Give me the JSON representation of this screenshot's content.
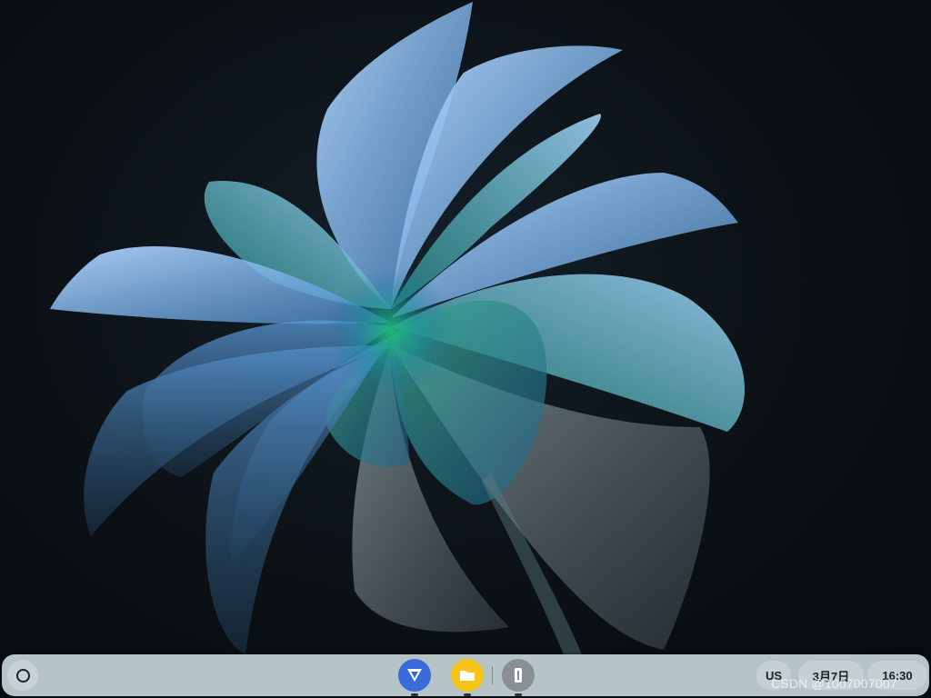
{
  "wallpaper": {
    "icon": "flower-wallpaper",
    "colors": [
      "#8ec5f0",
      "#4a9bd8",
      "#1aa07a",
      "#0b1014"
    ]
  },
  "shelf": {
    "launcher_icon": "launcher-circle-icon",
    "apps": [
      {
        "icon": "arrow-app-icon",
        "color": "#3b6bd8"
      },
      {
        "icon": "folder-icon",
        "color": "#f5c518"
      },
      {
        "icon": "terminal-icon",
        "color": "#8a8f93"
      }
    ],
    "ime_label": "US",
    "date_label": "3月7日",
    "time_label": "16:30"
  },
  "watermark": "CSDN @1007007007"
}
